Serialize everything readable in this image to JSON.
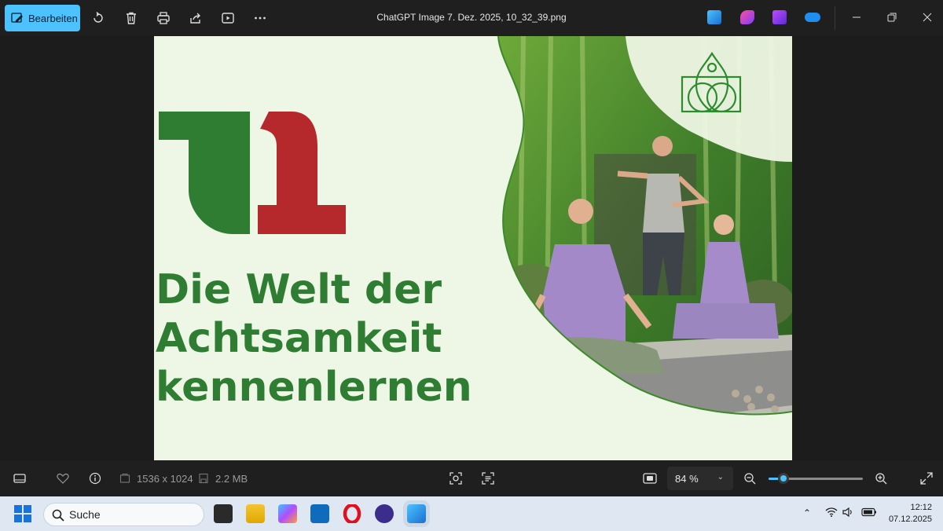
{
  "toolbar": {
    "edit_label": "Bearbeiten",
    "icons": [
      "rotate-icon",
      "delete-icon",
      "print-icon",
      "share-icon",
      "slideshow-icon",
      "more-icon"
    ]
  },
  "window": {
    "title": "ChatGPT Image 7. Dez. 2025, 10_32_39.png",
    "controls": [
      "minimize-icon",
      "restore-icon",
      "close-icon"
    ]
  },
  "image_content": {
    "headline_line1": "Die Welt der",
    "headline_line2": "Achtsamkeit",
    "headline_line3": "kennenlernen",
    "colors": {
      "green": "#2e7d32",
      "red": "#b5292c",
      "background": "#eef6e6"
    }
  },
  "statusbar": {
    "dimensions": "1536 x 1024",
    "filesize": "2.2 MB",
    "zoom_value": "84 %",
    "zoom_fraction": 0.16
  },
  "taskbar": {
    "search_placeholder": "Suche",
    "time": "12:12",
    "date": "07.12.2025"
  }
}
